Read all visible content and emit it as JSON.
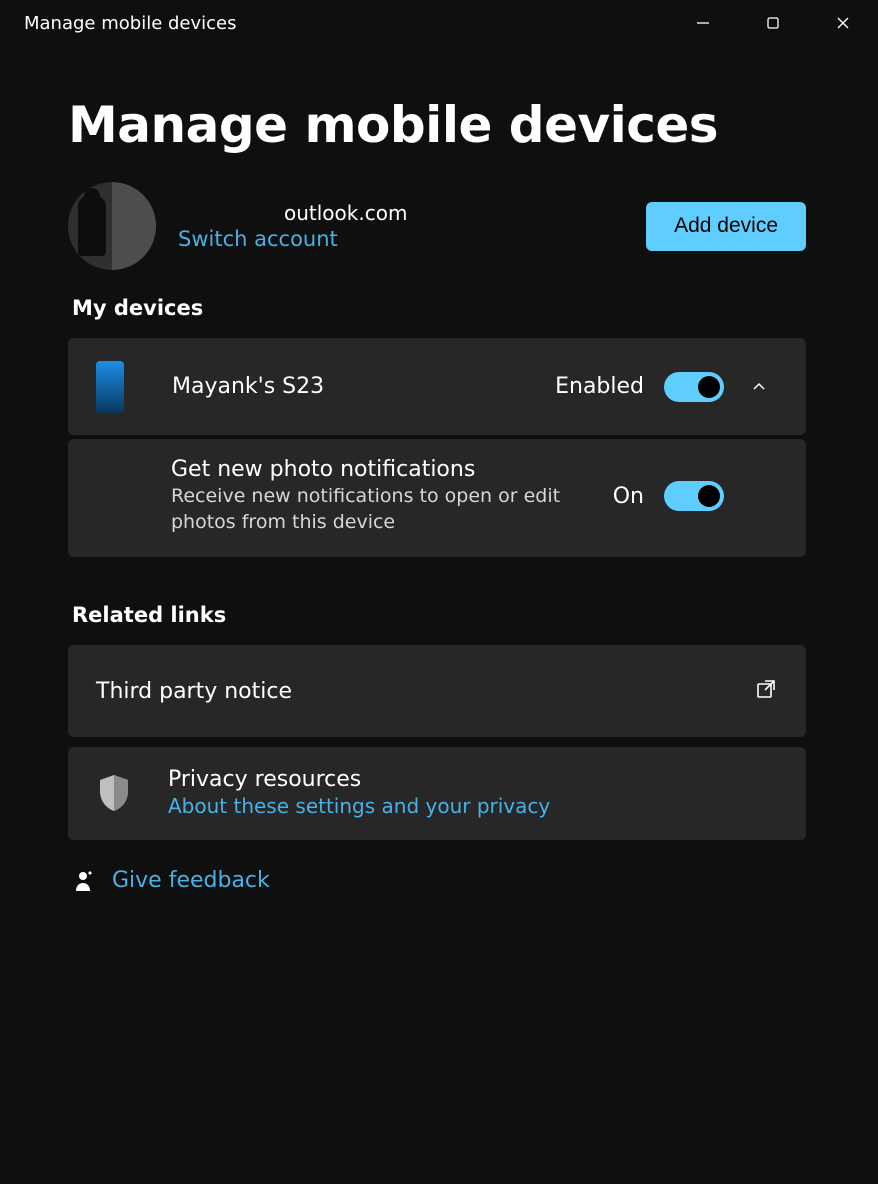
{
  "window": {
    "title": "Manage mobile devices"
  },
  "header": {
    "page_title": "Manage mobile devices",
    "account_email": "outlook.com",
    "switch_account_label": "Switch account",
    "add_device_label": "Add device"
  },
  "sections": {
    "my_devices_heading": "My devices",
    "related_links_heading": "Related links"
  },
  "device": {
    "name": "Mayank's S23",
    "status_label": "Enabled",
    "photo_notify_title": "Get new photo notifications",
    "photo_notify_desc": "Receive new notifications to open or edit photos from this device",
    "photo_notify_state": "On"
  },
  "related": {
    "third_party_label": "Third party notice",
    "privacy_title": "Privacy resources",
    "privacy_link_label": "About these settings and your privacy"
  },
  "feedback": {
    "label": "Give feedback"
  },
  "colors": {
    "accent": "#60cdff",
    "link": "#47b1e8",
    "card_bg": "#272727"
  }
}
